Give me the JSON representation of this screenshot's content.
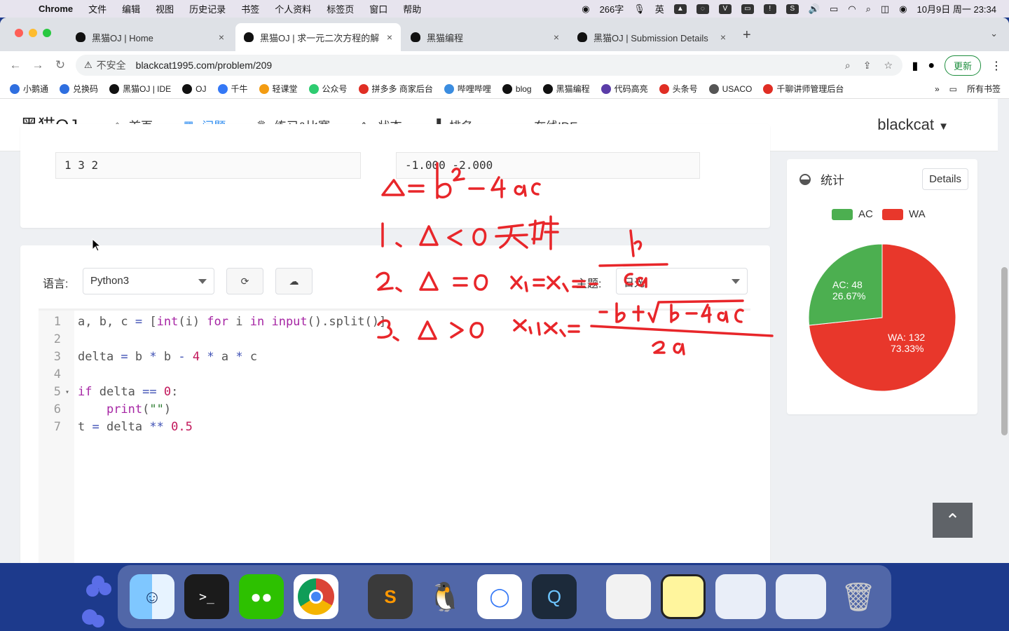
{
  "menubar": {
    "app": "Chrome",
    "items": [
      "文件",
      "编辑",
      "视图",
      "历史记录",
      "书签",
      "个人资料",
      "标签页",
      "窗口",
      "帮助"
    ],
    "status_chars": "266字",
    "input_method": "英",
    "datetime": "10月9日 周一 23:34"
  },
  "tabs": [
    {
      "title": "黑猫OJ | Home",
      "close": "×"
    },
    {
      "title": "黑猫OJ | 求一元二次方程的解",
      "close": "×"
    },
    {
      "title": "黑猫编程",
      "close": "×"
    },
    {
      "title": "黑猫OJ | Submission Details",
      "close": "×"
    }
  ],
  "newtab": "+",
  "toolbar": {
    "security_label": "不安全",
    "url": "blackcat1995.com/problem/209",
    "update_label": "更新"
  },
  "bookmarks": [
    {
      "label": "小鹅通",
      "color": "#2f6fe0"
    },
    {
      "label": "兑换码",
      "color": "#2f6fe0"
    },
    {
      "label": "黑猫OJ | IDE",
      "color": "#111111"
    },
    {
      "label": "OJ",
      "color": "#111111"
    },
    {
      "label": "千牛",
      "color": "#3478f6"
    },
    {
      "label": "轻课堂",
      "color": "#f39c12"
    },
    {
      "label": "公众号",
      "color": "#2ecc71"
    },
    {
      "label": "拼多多 商家后台",
      "color": "#e02e24"
    },
    {
      "label": "哔哩哔哩",
      "color": "#3b8de0"
    },
    {
      "label": "blog",
      "color": "#111111"
    },
    {
      "label": "黑猫编程",
      "color": "#111111"
    },
    {
      "label": "代码高亮",
      "color": "#5b3da8"
    },
    {
      "label": "头条号",
      "color": "#e02e24"
    },
    {
      "label": "USACO",
      "color": "#555555"
    },
    {
      "label": "千聊讲师管理后台",
      "color": "#e02e24"
    }
  ],
  "bookmarks_more": "»",
  "bookmarks_all": "所有书签",
  "site": {
    "logo": "黑猫OJ",
    "nav": [
      {
        "label": "首页",
        "icon": "home-icon",
        "glyph": "⌂"
      },
      {
        "label": "问题",
        "icon": "grid-icon",
        "glyph": "⋮⋮"
      },
      {
        "label": "练习&比赛",
        "icon": "trophy-icon",
        "glyph": "🏆"
      },
      {
        "label": "状态",
        "icon": "pulse-icon",
        "glyph": "∿"
      },
      {
        "label": "排名",
        "icon": "bar-chart-icon",
        "glyph": "▟"
      },
      {
        "label": "在线IDE",
        "icon": "cloud-icon",
        "glyph": "☁"
      }
    ],
    "user": "blackcat"
  },
  "sample": {
    "input": "1 3 2",
    "output": "-1.000 -2.000"
  },
  "editor": {
    "language_label": "语言:",
    "language_value": "Python3",
    "theme_label": "主题:",
    "theme_value": "日光",
    "lines": [
      "1",
      "2",
      "3",
      "4",
      "5",
      "6",
      "7"
    ]
  },
  "stats": {
    "title": "统计",
    "details_label": "Details",
    "legend_ac": "AC",
    "legend_wa": "WA",
    "ac_label": "AC: 48",
    "ac_pct": "26.67%",
    "wa_label": "WA: 132",
    "wa_pct": "73.33%",
    "ac_color": "#4caf50",
    "wa_color": "#e8372b"
  },
  "annotations": {
    "l1": "Δ = b² − 4ac",
    "l2": "1、Δ < 0 无解",
    "l3": "2、Δ = 0  x₁ = x₂ = −b/2a",
    "l4": "3、Δ > 0  x₁, x₂ = (−b ± √(b²−4ac)) / 2a"
  }
}
